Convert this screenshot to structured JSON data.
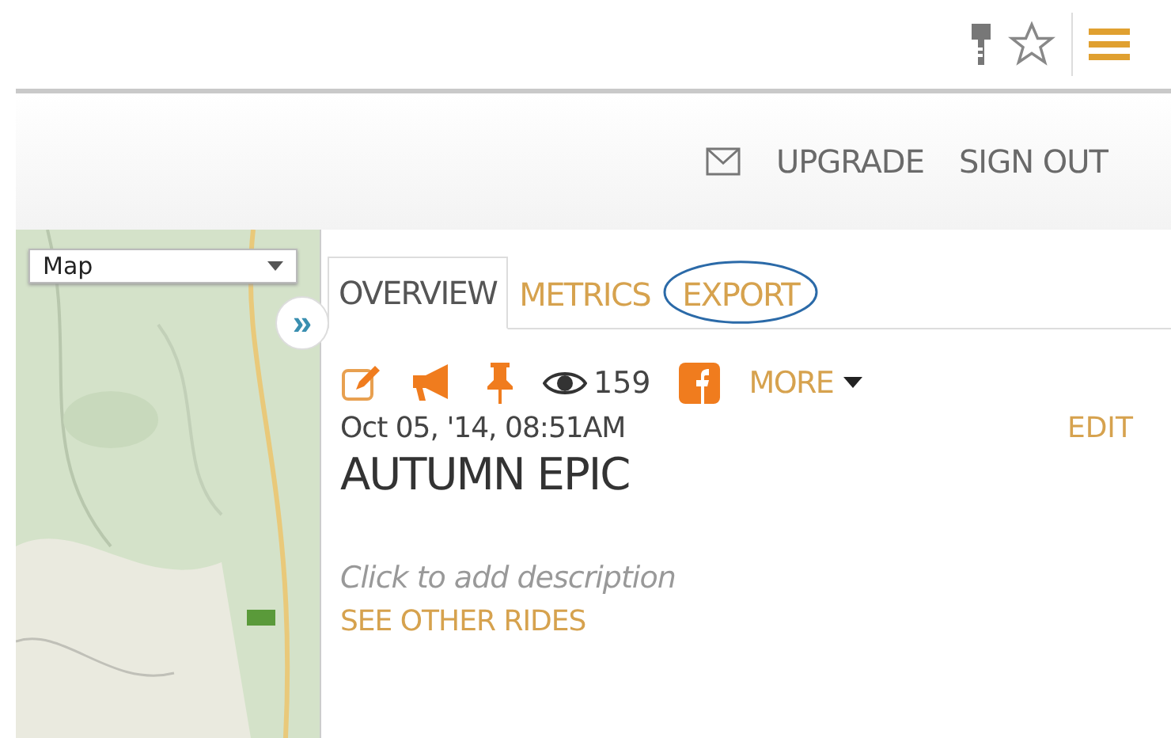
{
  "browser_toolbar": {
    "icons": [
      {
        "kind": "key"
      },
      {
        "kind": "star"
      },
      {
        "kind": "menu"
      }
    ]
  },
  "header": {
    "links": [
      {
        "kind": "mail"
      },
      {
        "kind": "text",
        "label": "UPGRADE"
      },
      {
        "kind": "text",
        "label": "SIGN OUT"
      }
    ]
  },
  "map": {
    "kind": "picture",
    "type_select": {
      "value": "Map"
    },
    "expand_button": "»"
  },
  "tabs": [
    {
      "label": "OVERVIEW",
      "selected": true,
      "circled": false
    },
    {
      "label": "METRICS",
      "selected": false,
      "circled": false
    },
    {
      "label": "EXPORT",
      "selected": false,
      "circled": true
    }
  ],
  "actions": [
    {
      "kind": "edit"
    },
    {
      "kind": "megaphone"
    },
    {
      "kind": "pin"
    },
    {
      "kind": "views",
      "count": "159"
    },
    {
      "kind": "facebook"
    },
    {
      "kind": "more",
      "label": "MORE"
    }
  ],
  "ride": {
    "date": "Oct 05, '14, 08:51AM",
    "edit": "EDIT",
    "title": "AUTUMN EPIC",
    "description_placeholder": "Click to add description",
    "see_other": "SEE OTHER RIDES"
  }
}
